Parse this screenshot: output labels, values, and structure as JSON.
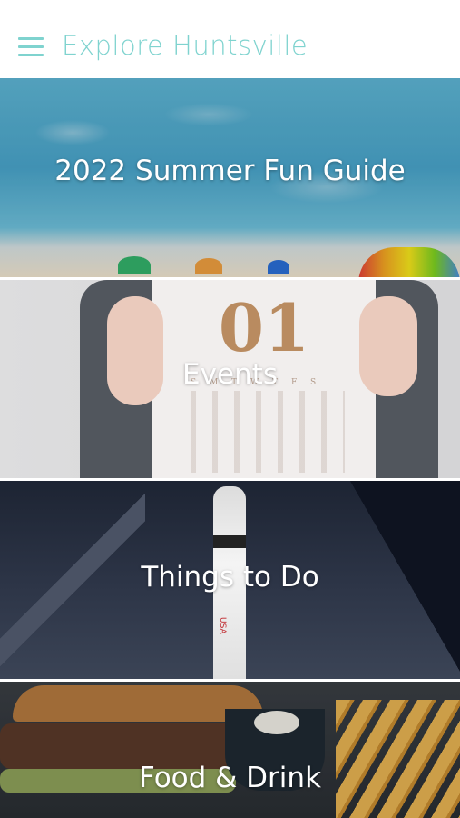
{
  "header": {
    "title": "Explore Huntsville",
    "menu_icon": "hamburger-menu-icon",
    "accent_color": "#7fd3cf"
  },
  "tiles": [
    {
      "label": "2022 Summer  Fun Guide",
      "image": "pool-toys-photo"
    },
    {
      "label": "Events",
      "image": "calendar-photo",
      "calendar_number": "01",
      "calendar_days": "S M T W T F S"
    },
    {
      "label": "Things to  Do",
      "image": "rocket-photo",
      "rocket_text": "USA"
    },
    {
      "label": "Food &  Drink",
      "image": "burger-fries-photo"
    }
  ]
}
